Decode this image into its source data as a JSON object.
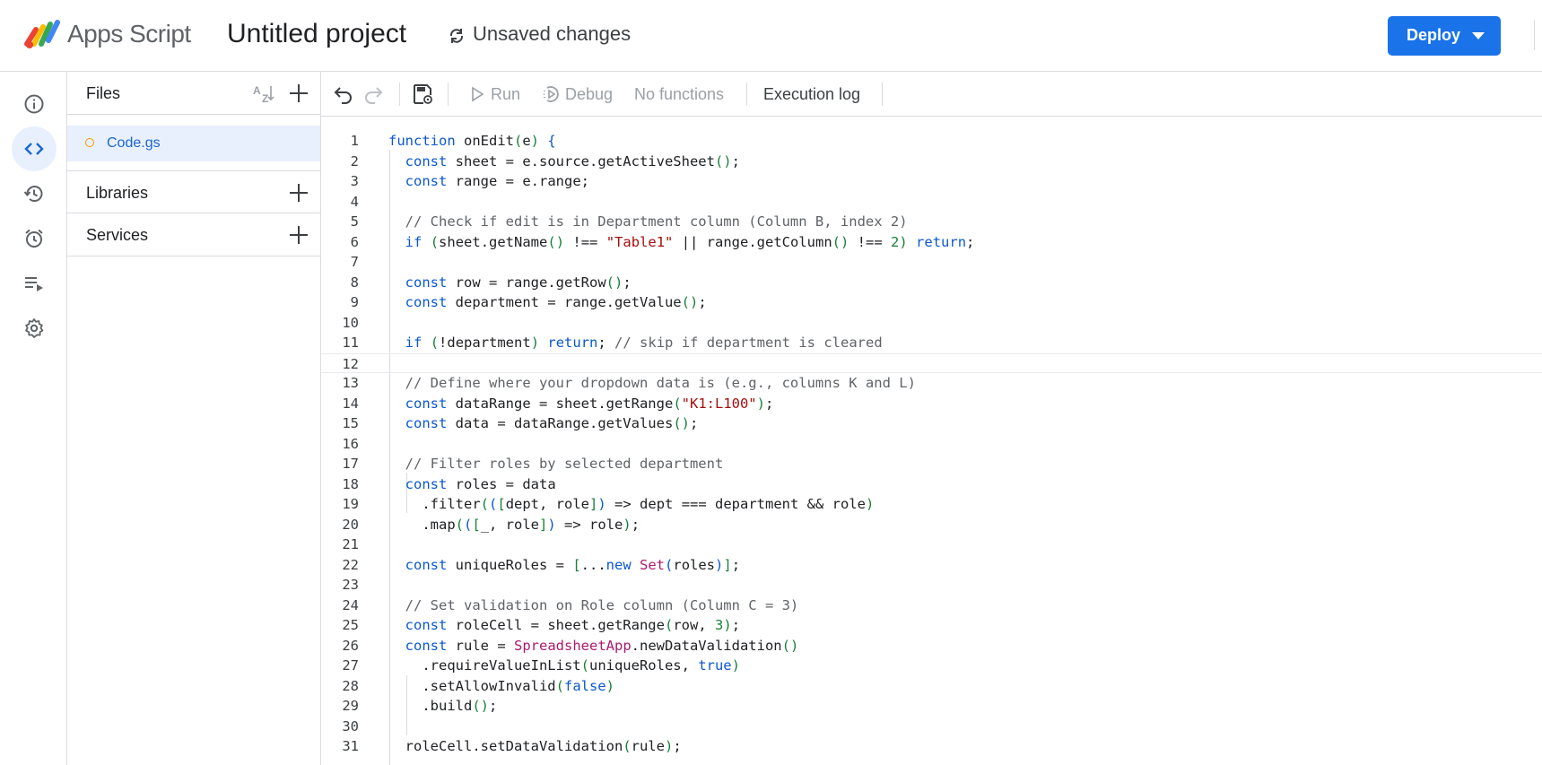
{
  "header": {
    "product_name": "Apps Script",
    "project_title": "Untitled project",
    "save_status": "Unsaved changes",
    "deploy_label": "Deploy"
  },
  "rail": {
    "items": [
      {
        "name": "overview",
        "icon": "info-icon"
      },
      {
        "name": "editor",
        "icon": "code-icon",
        "active": true
      },
      {
        "name": "executions-history",
        "icon": "history-icon"
      },
      {
        "name": "triggers",
        "icon": "alarm-clock-icon"
      },
      {
        "name": "executions",
        "icon": "playlist-play-icon"
      },
      {
        "name": "settings",
        "icon": "gear-icon"
      }
    ]
  },
  "files_panel": {
    "files_title": "Files",
    "files": [
      {
        "name": "Code.gs",
        "selected": true
      }
    ],
    "libraries_title": "Libraries",
    "services_title": "Services"
  },
  "toolbar": {
    "run_label": "Run",
    "debug_label": "Debug",
    "function_select": "No functions",
    "execution_log_label": "Execution log"
  },
  "editor": {
    "current_line": 12,
    "lines": [
      {
        "n": "1",
        "html": "<span class=\"kw\">function</span> onEdit<span class=\"br\">(</span>e<span class=\"br\">)</span> <span class=\"gd\">{</span>"
      },
      {
        "n": "2",
        "html": "  <span class=\"kw\">const</span> sheet = e.source.getActiveSheet<span class=\"br\">()</span>;"
      },
      {
        "n": "3",
        "html": "  <span class=\"kw\">const</span> range = e.range;"
      },
      {
        "n": "4",
        "html": ""
      },
      {
        "n": "5",
        "html": "  <span class=\"cm\">// Check if edit is in Department column (Column B, index 2)</span>"
      },
      {
        "n": "6",
        "html": "  <span class=\"kw\">if</span> <span class=\"br\">(</span>sheet.getName<span class=\"br\">()</span> !== <span class=\"st\">\"Table1\"</span> || range.getColumn<span class=\"br\">()</span> !== <span class=\"nm\">2</span><span class=\"br\">)</span> <span class=\"kw\">return</span>;"
      },
      {
        "n": "7",
        "html": ""
      },
      {
        "n": "8",
        "html": "  <span class=\"kw\">const</span> row = range.getRow<span class=\"br\">()</span>;"
      },
      {
        "n": "9",
        "html": "  <span class=\"kw\">const</span> department = range.getValue<span class=\"br\">()</span>;"
      },
      {
        "n": "10",
        "html": ""
      },
      {
        "n": "11",
        "html": "  <span class=\"kw\">if</span> <span class=\"br\">(</span>!department<span class=\"br\">)</span> <span class=\"kw\">return</span>; <span class=\"cm\">// skip if department is cleared</span>"
      },
      {
        "n": "12",
        "html": ""
      },
      {
        "n": "13",
        "html": "  <span class=\"cm\">// Define where your dropdown data is (e.g., columns K and L)</span>"
      },
      {
        "n": "14",
        "html": "  <span class=\"kw\">const</span> dataRange = sheet.getRange<span class=\"br\">(</span><span class=\"st\">\"K1:L100\"</span><span class=\"br\">)</span>;"
      },
      {
        "n": "15",
        "html": "  <span class=\"kw\">const</span> data = dataRange.getValues<span class=\"br\">()</span>;"
      },
      {
        "n": "16",
        "html": ""
      },
      {
        "n": "17",
        "html": "  <span class=\"cm\">// Filter roles by selected department</span>"
      },
      {
        "n": "18",
        "html": "  <span class=\"kw\">const</span> roles = data"
      },
      {
        "n": "19",
        "html": "    .filter<span class=\"br\">(</span><span class=\"gd\">(</span><span class=\"br\">[</span>dept, role<span class=\"br\">]</span><span class=\"gd\">)</span> =&gt; dept === department &amp;&amp; role<span class=\"br\">)</span>"
      },
      {
        "n": "20",
        "html": "    .map<span class=\"br\">(</span><span class=\"gd\">(</span><span class=\"br\">[</span>_, role<span class=\"br\">]</span><span class=\"gd\">)</span> =&gt; role<span class=\"br\">)</span>;"
      },
      {
        "n": "21",
        "html": ""
      },
      {
        "n": "22",
        "html": "  <span class=\"kw\">const</span> uniqueRoles = <span class=\"br\">[</span>...<span class=\"kw\">new</span> <span class=\"cl\">Set</span><span class=\"gd\">(</span>roles<span class=\"gd\">)</span><span class=\"br\">]</span>;"
      },
      {
        "n": "23",
        "html": ""
      },
      {
        "n": "24",
        "html": "  <span class=\"cm\">// Set validation on Role column (Column C = 3)</span>"
      },
      {
        "n": "25",
        "html": "  <span class=\"kw\">const</span> roleCell = sheet.getRange<span class=\"br\">(</span>row, <span class=\"nm\">3</span><span class=\"br\">)</span>;"
      },
      {
        "n": "26",
        "html": "  <span class=\"kw\">const</span> rule = <span class=\"cl\">SpreadsheetApp</span>.newDataValidation<span class=\"br\">()</span>"
      },
      {
        "n": "27",
        "html": "    .requireValueInList<span class=\"br\">(</span>uniqueRoles, <span class=\"kw\">true</span><span class=\"br\">)</span>"
      },
      {
        "n": "28",
        "html": "    .setAllowInvalid<span class=\"br\">(</span><span class=\"kw\">false</span><span class=\"br\">)</span>"
      },
      {
        "n": "29",
        "html": "    .build<span class=\"br\">()</span>;"
      },
      {
        "n": "30",
        "html": ""
      },
      {
        "n": "31",
        "html": "  roleCell.setDataValidation<span class=\"br\">(</span>rule<span class=\"br\">)</span>;"
      }
    ]
  }
}
